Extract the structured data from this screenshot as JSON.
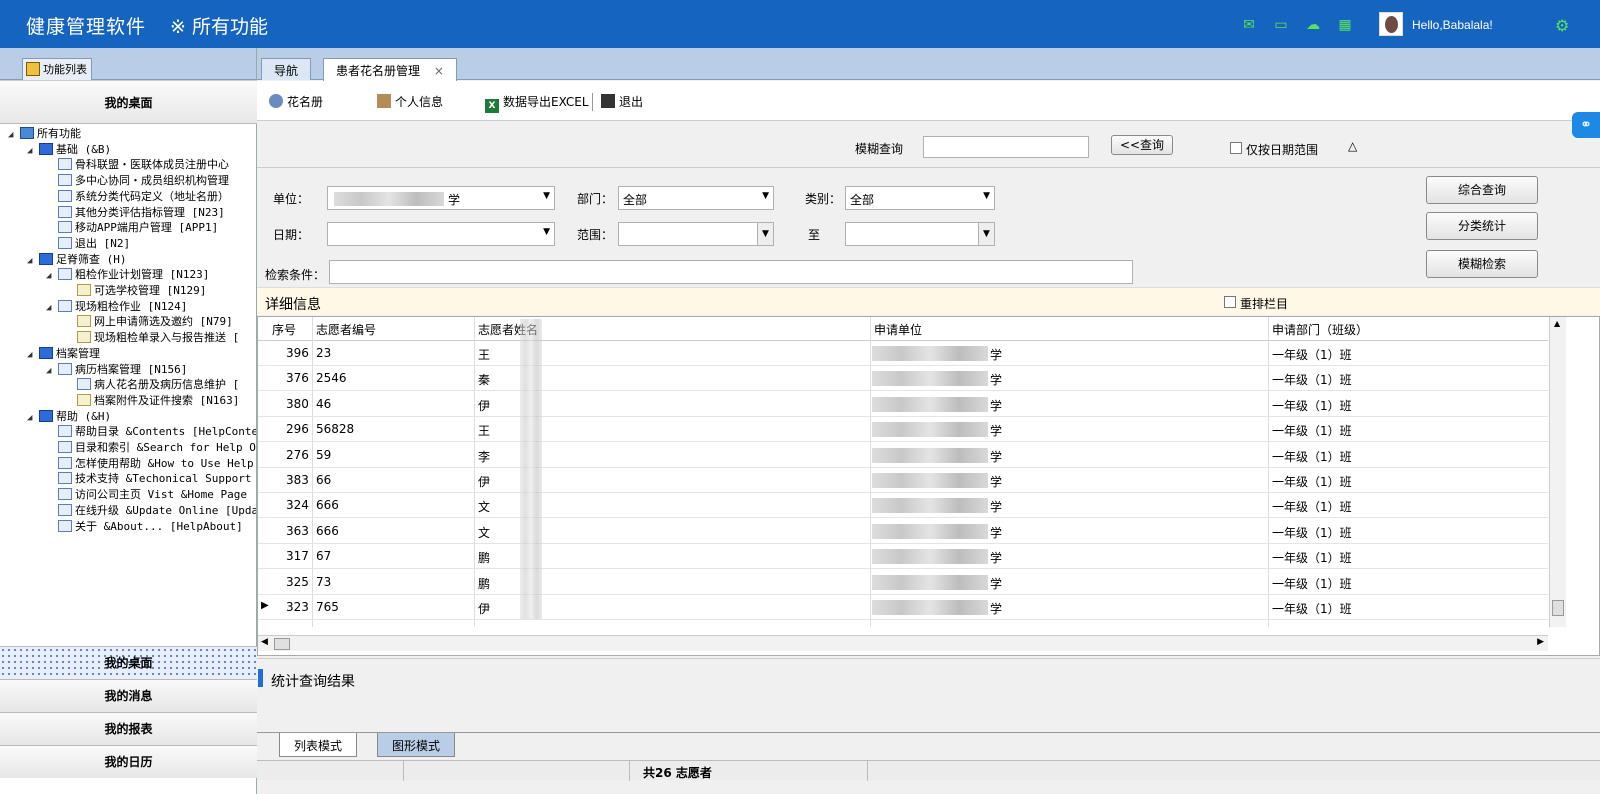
{
  "header": {
    "app_title": "健康管理软件",
    "all_functions": "※ 所有功能",
    "greeting": "Hello,Babalala!",
    "icons": [
      "mail-icon",
      "chat-icon",
      "upload-cloud-icon",
      "calendar-icon"
    ],
    "accent_color": "#1565c0"
  },
  "left_panel": {
    "tab_label": "功能列表",
    "top_nav": "我的桌面",
    "tree": [
      {
        "label": "所有功能",
        "level": 0,
        "kind": "root",
        "glyph": "◢"
      },
      {
        "label": "基础 (&B)",
        "level": 1,
        "kind": "cube",
        "glyph": "◢"
      },
      {
        "label": "骨科联盟・医联体成员注册中心",
        "level": 2,
        "kind": "page",
        "glyph": ""
      },
      {
        "label": "多中心协同・成员组织机构管理",
        "level": 2,
        "kind": "page",
        "glyph": ""
      },
      {
        "label": "系统分类代码定义（地址名册）",
        "level": 2,
        "kind": "page",
        "glyph": ""
      },
      {
        "label": "其他分类评估指标管理 [N23]",
        "level": 2,
        "kind": "page",
        "glyph": ""
      },
      {
        "label": "移动APP端用户管理 [APP1]",
        "level": 2,
        "kind": "page",
        "glyph": ""
      },
      {
        "label": "退出 [N2]",
        "level": 2,
        "kind": "page",
        "glyph": ""
      },
      {
        "label": "足脊筛查 (H)",
        "level": 1,
        "kind": "cube",
        "glyph": "◢"
      },
      {
        "label": "粗检作业计划管理 [N123]",
        "level": 2,
        "kind": "page",
        "glyph": "◢"
      },
      {
        "label": "可选学校管理 [N129]",
        "level": 3,
        "kind": "leaf",
        "glyph": ""
      },
      {
        "label": "现场粗检作业 [N124]",
        "level": 2,
        "kind": "page",
        "glyph": "◢"
      },
      {
        "label": "网上申请筛选及邀约 [N79]",
        "level": 3,
        "kind": "leaf",
        "glyph": ""
      },
      {
        "label": "现场粗检单录入与报告推送 [",
        "level": 3,
        "kind": "leaf",
        "glyph": ""
      },
      {
        "label": "档案管理",
        "level": 1,
        "kind": "cube",
        "glyph": "◢"
      },
      {
        "label": "病历档案管理 [N156]",
        "level": 2,
        "kind": "page",
        "glyph": "◢"
      },
      {
        "label": "病人花名册及病历信息维护 [",
        "level": 3,
        "kind": "page",
        "glyph": ""
      },
      {
        "label": "档案附件及证件搜索 [N163]",
        "level": 3,
        "kind": "leaf",
        "glyph": ""
      },
      {
        "label": "帮助 (&H)",
        "level": 1,
        "kind": "cube",
        "glyph": "◢"
      },
      {
        "label": "帮助目录 &Contents [HelpConter",
        "level": 2,
        "kind": "page",
        "glyph": ""
      },
      {
        "label": "目录和索引 &Search for Help Or",
        "level": 2,
        "kind": "page",
        "glyph": ""
      },
      {
        "label": "怎样使用帮助 &How to Use Help",
        "level": 2,
        "kind": "page",
        "glyph": ""
      },
      {
        "label": "技术支持 &Techonical Support",
        "level": 2,
        "kind": "page",
        "glyph": ""
      },
      {
        "label": "访问公司主页 Vist &Home Page",
        "level": 2,
        "kind": "page",
        "glyph": ""
      },
      {
        "label": "在线升级 &Update Online [Upda",
        "level": 2,
        "kind": "page",
        "glyph": ""
      },
      {
        "label": "关于 &About... [HelpAbout]",
        "level": 2,
        "kind": "page",
        "glyph": ""
      }
    ],
    "bottom_navs": [
      "我的桌面",
      "我的消息",
      "我的报表",
      "我的日历"
    ]
  },
  "tabs": [
    {
      "label": "导航",
      "active": false
    },
    {
      "label": "患者花名册管理",
      "active": true,
      "close": "×"
    }
  ],
  "toolbar": {
    "roster": "花名册",
    "personal": "个人信息",
    "export": "数据导出EXCEL",
    "exit": "退出"
  },
  "search": {
    "fuzzy_label": "模糊查询",
    "fuzzy_value": "",
    "query_button": "<<查询",
    "date_only_label": "仅按日期范围",
    "collapse_glyph": "△"
  },
  "filters": {
    "unit_label": "单位：",
    "unit_value_suffix": "学",
    "dept_label": "部门：",
    "dept_value": "全部",
    "category_label": "类别：",
    "category_value": "全部",
    "date_label": "日期：",
    "range_label": "范围：",
    "to_label": "至",
    "criteria_label": "检索条件：",
    "criteria_value": ""
  },
  "side_buttons": [
    "综合查询",
    "分类统计",
    "模糊检索"
  ],
  "detail": {
    "title": "详细信息",
    "rearrange_label": "重排栏目",
    "columns": [
      "序号",
      "志愿者编号",
      "志愿者姓名",
      "申请单位",
      "申请部门（班级）"
    ],
    "rows": [
      {
        "seq": "396",
        "id": "23",
        "name": "王",
        "unit": "学",
        "dept": "一年级（1）班"
      },
      {
        "seq": "376",
        "id": "2546",
        "name": "秦",
        "unit": "学",
        "dept": "一年级（1）班"
      },
      {
        "seq": "380",
        "id": "46",
        "name": "伊",
        "unit": "学",
        "dept": "一年级（1）班"
      },
      {
        "seq": "296",
        "id": "56828",
        "name": "王",
        "unit": "学",
        "dept": "一年级（1）班"
      },
      {
        "seq": "276",
        "id": "59",
        "name": "李",
        "unit": "学",
        "dept": "一年级（1）班"
      },
      {
        "seq": "383",
        "id": "66",
        "name": "伊",
        "unit": "学",
        "dept": "一年级（1）班"
      },
      {
        "seq": "324",
        "id": "666",
        "name": "文",
        "unit": "学",
        "dept": "一年级（1）班"
      },
      {
        "seq": "363",
        "id": "666",
        "name": "文",
        "unit": "学",
        "dept": "一年级（1）班"
      },
      {
        "seq": "317",
        "id": "67",
        "name": "鹏",
        "unit": "学",
        "dept": "一年级（1）班"
      },
      {
        "seq": "325",
        "id": "73",
        "name": "鹏",
        "unit": "学",
        "dept": "一年级（1）班"
      },
      {
        "seq": "323",
        "id": "765",
        "name": "伊",
        "unit": "学",
        "dept": "一年级（1）班",
        "current": true
      }
    ]
  },
  "stats": {
    "title": "统计查询结果",
    "modes": [
      "列表模式",
      "图形模式"
    ],
    "status_text": "共26 志愿者"
  }
}
